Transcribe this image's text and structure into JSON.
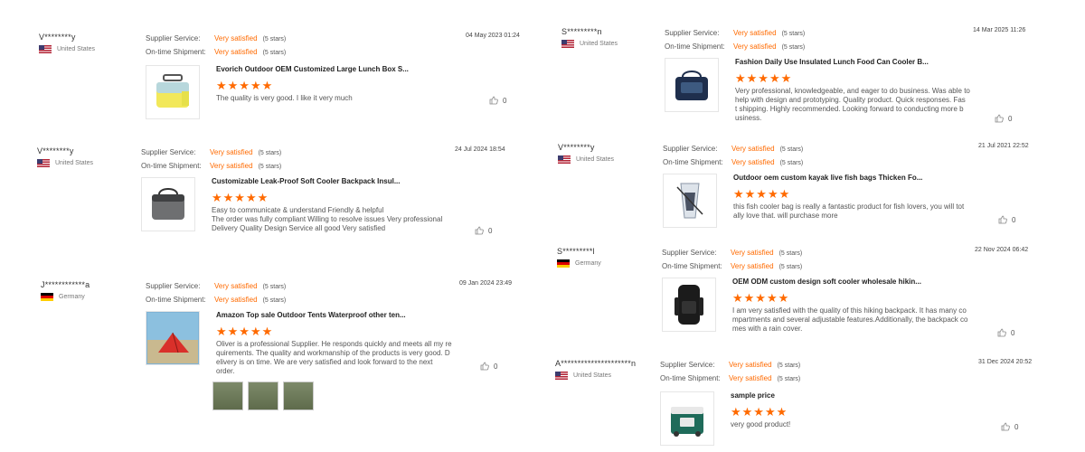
{
  "labels": {
    "supplier_service": "Supplier Service:",
    "on_time_shipment": "On-time Shipment:"
  },
  "colors": {
    "accent": "#ff6a00"
  },
  "reviews": [
    {
      "user": "V********y",
      "country": "United States",
      "supplier_service": "Very satisfied",
      "supplier_stars": "(5 stars)",
      "on_time": "Very satisfied",
      "on_time_stars": "(5 stars)",
      "date": "04 May 2023 01:24",
      "product": "Evorich Outdoor OEM Customized Large Lunch Box S...",
      "rating": 5,
      "text": "The quality is very good. I like it very much",
      "likes": "0",
      "thumb_icon": "yellow-lunch-box-icon"
    },
    {
      "user": "V********y",
      "country": "United States",
      "supplier_service": "Very satisfied",
      "supplier_stars": "(5 stars)",
      "on_time": "Very satisfied",
      "on_time_stars": "(5 stars)",
      "date": "24 Jul 2024 18:54",
      "product": "Customizable Leak-Proof Soft Cooler Backpack Insul...",
      "rating": 5,
      "text": "Easy to communicate & understand Friendly & helpful\nThe order was fully compliant Willing to resolve issues Very professional\nDelivery Quality Design Service all good Very satisfied",
      "likes": "0",
      "thumb_icon": "gray-cooler-bag-icon"
    },
    {
      "user": "J************a",
      "country": "Germany",
      "supplier_service": "Very satisfied",
      "supplier_stars": "(5 stars)",
      "on_time": "Very satisfied",
      "on_time_stars": "(5 stars)",
      "date": "09 Jan 2024 23:49",
      "product": "Amazon Top sale Outdoor Tents Waterproof other ten...",
      "rating": 5,
      "text": "Oliver is a professional Supplier. He responds quickly and meets all my re\nquirements. The quality and workmanship of the products is very good. D\nelivery is on time. We are very satisfied and look forward to the next order.",
      "likes": "0",
      "thumb_icon": "red-tent-icon"
    },
    {
      "user": "S*********n",
      "country": "United States",
      "supplier_service": "Very satisfied",
      "supplier_stars": "(5 stars)",
      "on_time": "Very satisfied",
      "on_time_stars": "(5 stars)",
      "date": "14 Mar 2025 11:26",
      "product": "Fashion Daily Use Insulated Lunch Food Can Cooler B...",
      "rating": 5,
      "text": "Very professional, knowledgeable, and eager to do business.  Was able to\nhelp with design and prototyping.  Quality product.  Quick responses.  Fas\nt shipping.  Highly recommended.  Looking forward to conducting more b\nusiness.",
      "likes": "0",
      "thumb_icon": "navy-cooler-bag-icon"
    },
    {
      "user": "V********y",
      "country": "United States",
      "supplier_service": "Very satisfied",
      "supplier_stars": "(5 stars)",
      "on_time": "Very satisfied",
      "on_time_stars": "(5 stars)",
      "date": "21 Jul 2021 22:52",
      "product": "Outdoor oem custom kayak live fish bags Thicken Fo...",
      "rating": 5,
      "text": "this fish cooler bag is really a fantastic product for fish lovers, you will tot\nally love that. will purchase more",
      "likes": "0",
      "thumb_icon": "fish-bag-icon"
    },
    {
      "user": "S*********l",
      "country": "Germany",
      "supplier_service": "Very satisfied",
      "supplier_stars": "(5 stars)",
      "on_time": "Very satisfied",
      "on_time_stars": "(5 stars)",
      "date": "22 Nov 2024 06:42",
      "product": "OEM ODM custom design soft cooler wholesale hikin...",
      "rating": 5,
      "text": "I am very satisfied with the quality of this hiking backpack. It has many co\nmpartments and several adjustable features.Additionally, the backpack co\nmes with a rain cover.",
      "likes": "0",
      "thumb_icon": "hiking-backpack-icon"
    },
    {
      "user": "A*********************n",
      "country": "United States",
      "supplier_service": "Very satisfied",
      "supplier_stars": "(5 stars)",
      "on_time": "Very satisfied",
      "on_time_stars": "(5 stars)",
      "date": "31 Dec 2024 20:52",
      "product": "sample price",
      "rating": 5,
      "text": "very good product!",
      "likes": "0",
      "thumb_icon": "green-cooler-box-icon"
    }
  ]
}
